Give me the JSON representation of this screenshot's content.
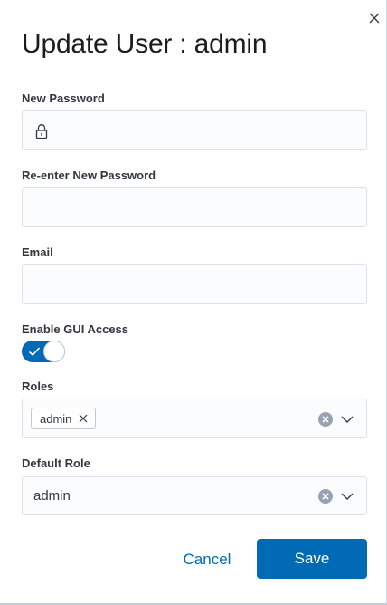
{
  "dialog": {
    "title": "Update User : admin",
    "close_icon": "close-icon"
  },
  "form": {
    "new_password": {
      "label": "New Password",
      "value": "",
      "icon": "lock-icon"
    },
    "reenter_password": {
      "label": "Re-enter New Password",
      "value": ""
    },
    "email": {
      "label": "Email",
      "value": ""
    },
    "gui_access": {
      "label": "Enable GUI Access",
      "enabled": true
    },
    "roles": {
      "label": "Roles",
      "selected": [
        "admin"
      ]
    },
    "default_role": {
      "label": "Default Role",
      "value": "admin"
    }
  },
  "actions": {
    "cancel_label": "Cancel",
    "save_label": "Save"
  },
  "colors": {
    "accent": "#006bb4",
    "field_bg": "#fbfcfd",
    "field_border": "#dde2ea"
  }
}
